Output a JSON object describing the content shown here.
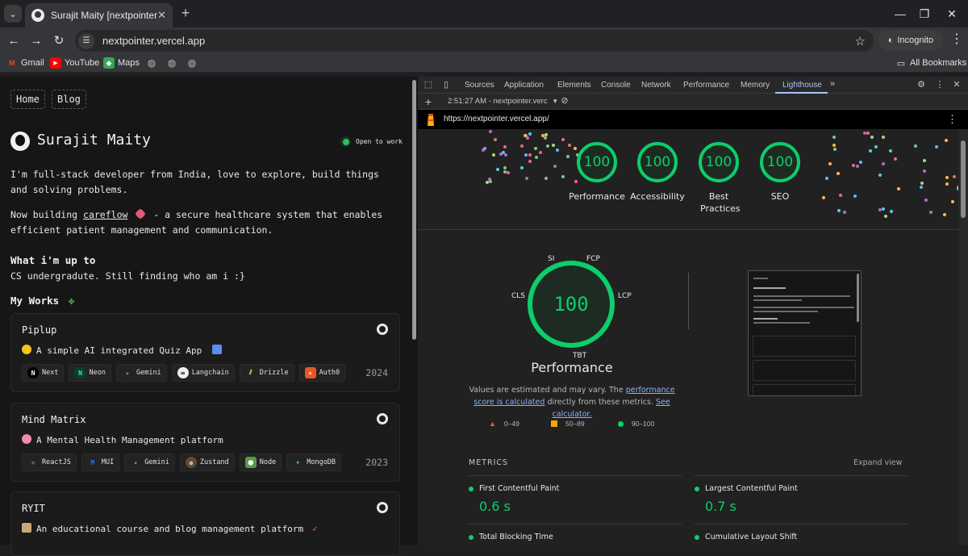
{
  "browser": {
    "tab_title": "Surajit Maity [nextpointer]",
    "url": "nextpointer.vercel.app",
    "profile": "Incognito",
    "bookmarks": [
      "Gmail",
      "YouTube",
      "Maps"
    ],
    "all_bookmarks": "All Bookmarks"
  },
  "site": {
    "nav": [
      "Home",
      "Blog"
    ],
    "name": "Surajit Maity",
    "status": "Open to work",
    "bio": "I'm full-stack developer from India, love to explore, build things and solving problems.",
    "building_prefix": "Now building",
    "building_link": "careflow",
    "building_suffix": "- a secure healthcare system that enables efficient patient management and communication.",
    "upto_heading": "What i'm up to",
    "upto_text": "CS undergradute. Still finding who am i :}",
    "works_heading": "My Works",
    "works": [
      {
        "title": "Piplup",
        "desc": "A simple AI integrated Quiz App",
        "year": "2024",
        "stack": [
          "Next",
          "Neon",
          "Gemini",
          "Langchain",
          "Drizzle",
          "Auth0"
        ]
      },
      {
        "title": "Mind Matrix",
        "desc": "A Mental Health Management platform",
        "year": "2023",
        "stack": [
          "ReactJS",
          "MUI",
          "Gemini",
          "Zustand",
          "Node",
          "MongoDB"
        ]
      },
      {
        "title": "RYIT",
        "desc": "An educational course and blog management platform",
        "year": "",
        "stack": []
      }
    ]
  },
  "devtools": {
    "tabs": [
      "Sources",
      "Application",
      "Elements",
      "Console",
      "Network",
      "Performance",
      "Memory",
      "Lighthouse"
    ],
    "active_tab": "Lighthouse",
    "report_select": "2:51:27 AM - nextpointer.verc",
    "report_url": "https://nextpointer.vercel.app/",
    "scores": [
      {
        "label": "Performance",
        "value": "100"
      },
      {
        "label": "Accessibility",
        "value": "100"
      },
      {
        "label": "Best Practices",
        "value": "100"
      },
      {
        "label": "SEO",
        "value": "100"
      }
    ],
    "perf": {
      "score": "100",
      "title": "Performance",
      "ticks": [
        "SI",
        "FCP",
        "LCP",
        "TBT",
        "CLS"
      ],
      "note_prefix": "Values are estimated and may vary. The",
      "note_link1": "performance score is calculated",
      "note_mid": "directly from these metrics.",
      "note_link2": "See calculator.",
      "legend": [
        "0–49",
        "50–89",
        "90–100"
      ]
    },
    "metrics_heading": "METRICS",
    "expand_view": "Expand view",
    "metrics": [
      {
        "name": "First Contentful Paint",
        "value": "0.6 s"
      },
      {
        "name": "Largest Contentful Paint",
        "value": "0.7 s"
      },
      {
        "name": "Total Blocking Time",
        "value": ""
      },
      {
        "name": "Cumulative Layout Shift",
        "value": ""
      }
    ]
  },
  "colors": {
    "pass": "#0cce6b",
    "average": "#ffa400",
    "fail": "#ff4e42",
    "link": "#8ab4f8"
  }
}
